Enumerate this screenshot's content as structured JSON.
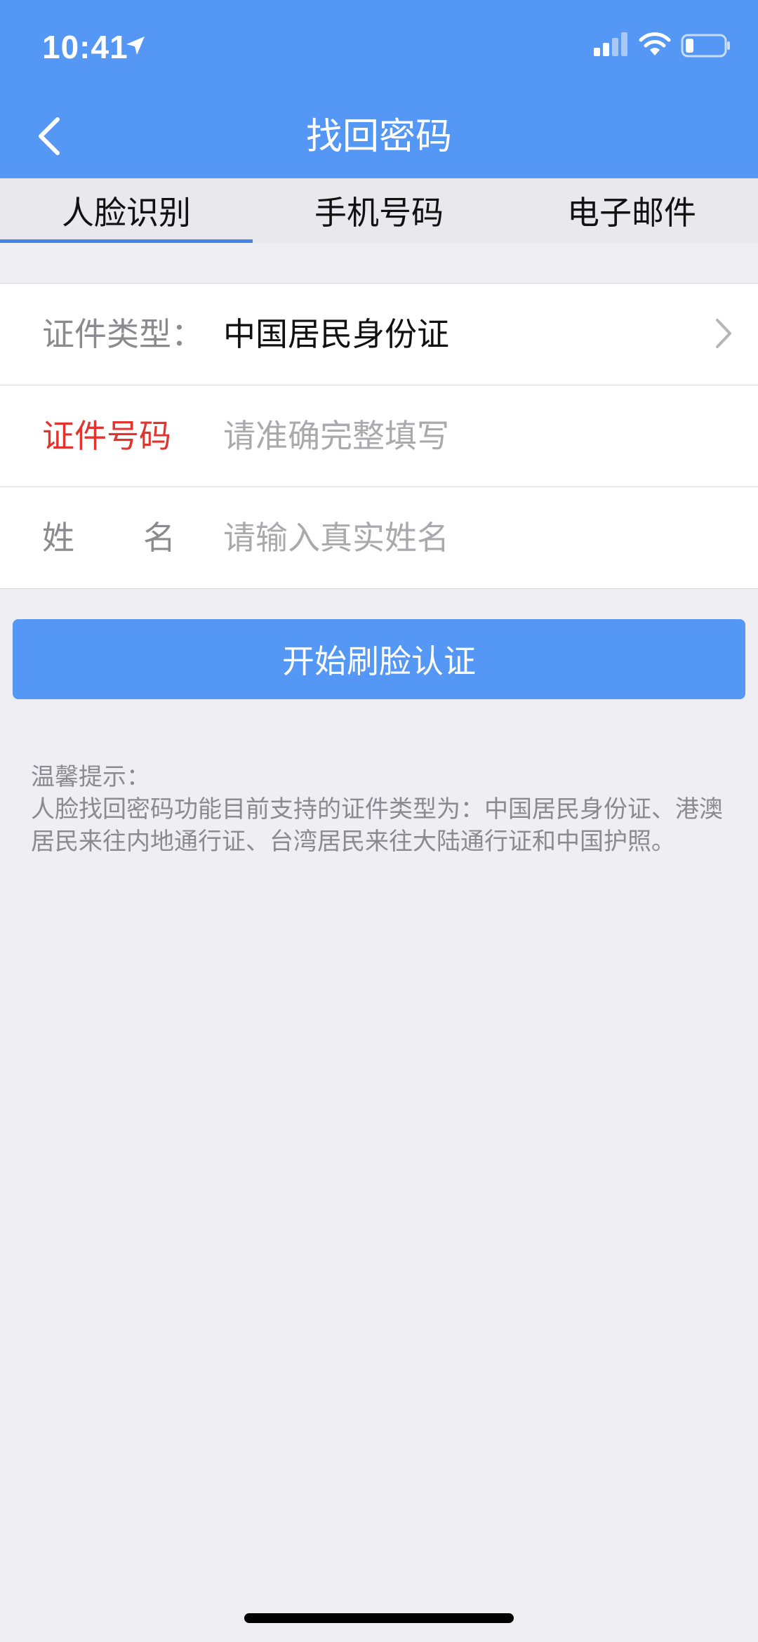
{
  "status_bar": {
    "time": "10:41"
  },
  "nav": {
    "title": "找回密码"
  },
  "tabs": [
    {
      "label": "人脸识别",
      "active": true
    },
    {
      "label": "手机号码",
      "active": false
    },
    {
      "label": "电子邮件",
      "active": false
    }
  ],
  "form": {
    "id_type": {
      "label": "证件类型：",
      "value": "中国居民身份证"
    },
    "id_number": {
      "label": "证件号码",
      "placeholder": "请准确完整填写"
    },
    "name": {
      "label_char1": "姓",
      "label_char2": "名",
      "placeholder": "请输入真实姓名"
    }
  },
  "start_button": {
    "label": "开始刷脸认证"
  },
  "tips": {
    "title": "温馨提示：",
    "body": "人脸找回密码功能目前支持的证件类型为：中国居民身份证、港澳居民来往内地通行证、台湾居民来往大陆通行证和中国护照。"
  },
  "colors": {
    "primary": "#5597f4",
    "background": "#eeeef3",
    "required_label": "#e2332f"
  }
}
